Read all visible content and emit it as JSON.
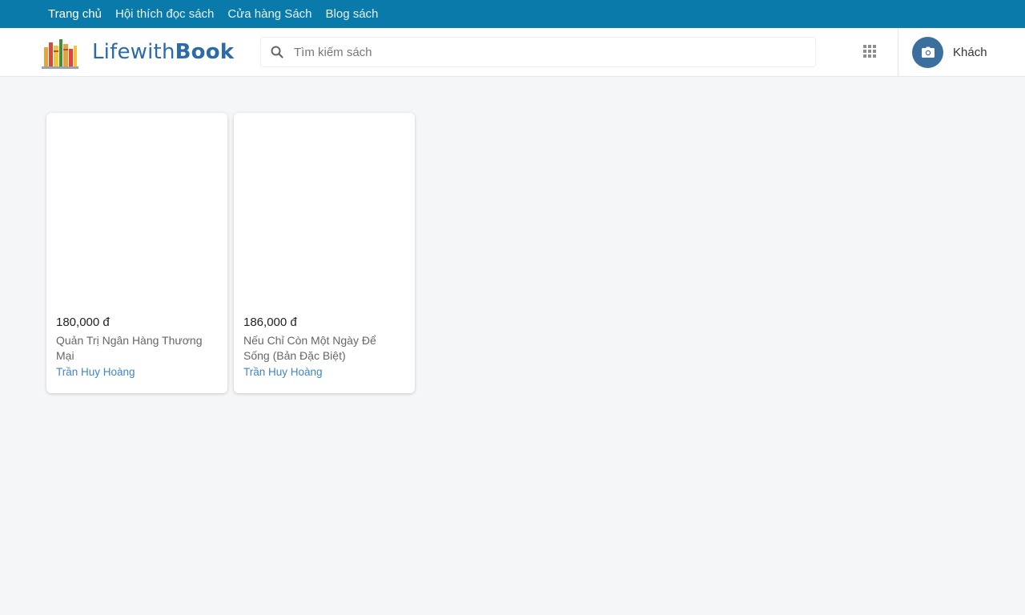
{
  "topnav": {
    "items": [
      {
        "label": "Trang chủ"
      },
      {
        "label": "Hội thích đọc sách"
      },
      {
        "label": "Cửa hàng Sách"
      },
      {
        "label": "Blog sách"
      }
    ]
  },
  "header": {
    "logo_text_light": "Lifewith",
    "logo_text_bold": "Book",
    "search": {
      "placeholder": "Tìm kiếm sách",
      "value": ""
    },
    "apps_icon": "grid-icon",
    "user": {
      "name": "Khách",
      "avatar_icon": "camera-icon"
    }
  },
  "colors": {
    "topnav_bg": "#0a7aab",
    "brand": "#2d6aa8",
    "author_link": "#3f86c7",
    "page_bg": "#f5f6f8"
  },
  "books": [
    {
      "price": "180,000 đ",
      "title": "Quản Trị Ngân Hàng Thương Mại",
      "author": "Trần Huy Hoàng"
    },
    {
      "price": "186,000 đ",
      "title": "Nếu Chỉ Còn Một Ngày Để Sống (Bản Đặc Biệt)",
      "author": "Trần Huy Hoàng"
    }
  ]
}
